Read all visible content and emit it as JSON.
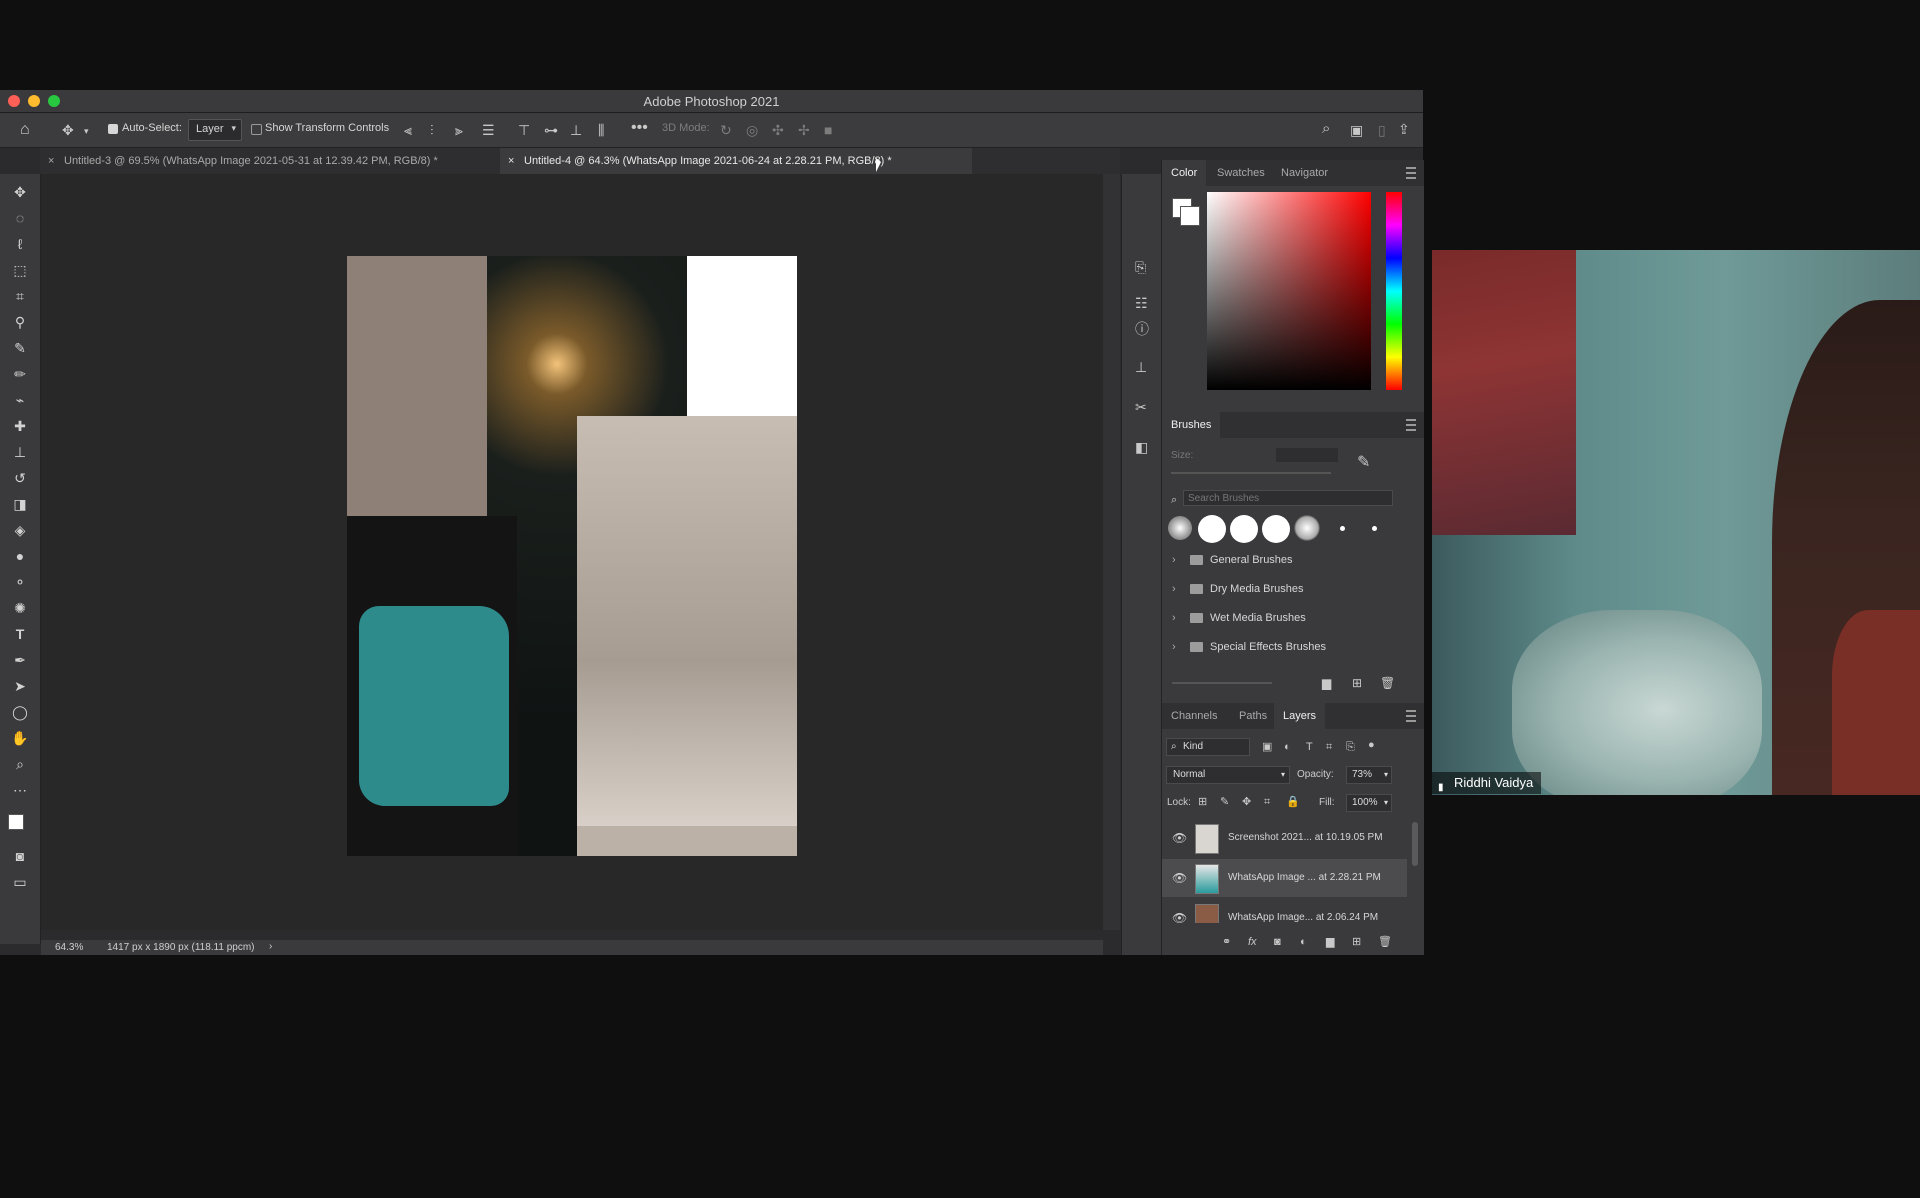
{
  "window": {
    "title": "Adobe Photoshop 2021"
  },
  "options_bar": {
    "auto_select_label": "Auto-Select:",
    "auto_select_value": "Layer",
    "show_transform_label": "Show Transform Controls",
    "mode_3d_label": "3D Mode:"
  },
  "tabs": [
    {
      "label": "Untitled-3 @ 69.5% (WhatsApp Image 2021-05-31 at 12.39.42 PM, RGB/8) *"
    },
    {
      "label": "Untitled-4 @ 64.3% (WhatsApp Image 2021-06-24 at 2.28.21 PM, RGB/8) *"
    }
  ],
  "status_bar": {
    "zoom": "64.3%",
    "doc_info": "1417 px x 1890 px (118.11 ppcm)"
  },
  "color_panel": {
    "tabs": [
      "Color",
      "Swatches",
      "Navigator"
    ]
  },
  "brushes_panel": {
    "title": "Brushes",
    "size_label": "Size:",
    "search_placeholder": "Search Brushes",
    "folders": [
      "General Brushes",
      "Dry Media Brushes",
      "Wet Media Brushes",
      "Special Effects Brushes"
    ]
  },
  "layers_panel": {
    "tabs": [
      "Channels",
      "Paths",
      "Layers"
    ],
    "kind_label": "Kind",
    "blend_mode": "Normal",
    "opacity_label": "Opacity:",
    "opacity_value": "73%",
    "lock_label": "Lock:",
    "fill_label": "Fill:",
    "fill_value": "100%",
    "layers": [
      {
        "name": "Screenshot 2021... at 10.19.05 PM"
      },
      {
        "name": "WhatsApp Image ... at 2.28.21 PM"
      },
      {
        "name": "WhatsApp Image... at 2.06.24 PM"
      }
    ]
  },
  "video": {
    "participant_name": "Riddhi Vaidya"
  }
}
